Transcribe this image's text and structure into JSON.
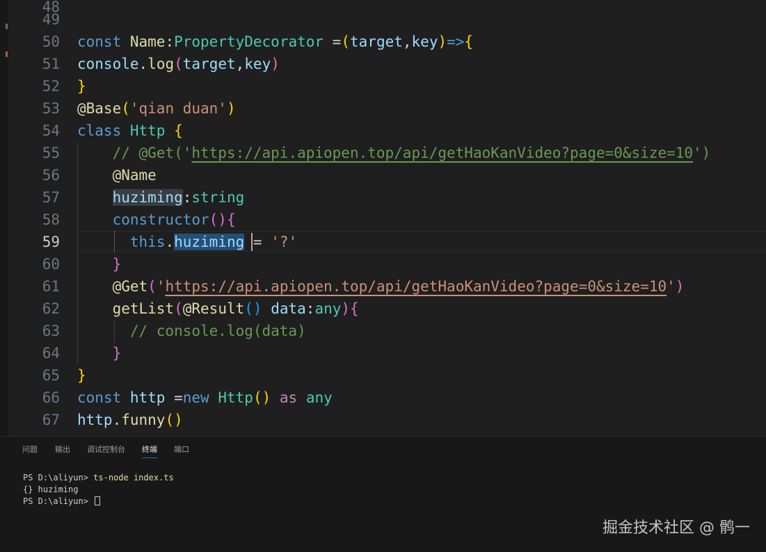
{
  "editor": {
    "line_numbers": [
      "48",
      "49",
      "50",
      "51",
      "52",
      "53",
      "54",
      "55",
      "56",
      "57",
      "58",
      "59",
      "60",
      "61",
      "62",
      "63",
      "64",
      "65",
      "66",
      "67"
    ],
    "active_line": "59",
    "comment_url": "https://api.apiopen.top/api/getHaoKanVideo?page=0&size=10",
    "string_url": "https://api.apiopen.top/api/getHaoKanVideo?page=0&size=10"
  },
  "panel": {
    "tabs": [
      "问题",
      "输出",
      "调试控制台",
      "终端",
      "端口"
    ],
    "active_tab": "终端",
    "terminal": {
      "prompt": "PS D:\\aliyun> ",
      "command": "ts-node index.ts",
      "output": "{} huziming",
      "prompt2": "PS D:\\aliyun> "
    }
  },
  "watermark": "掘金技术社区 @ 鹘一"
}
